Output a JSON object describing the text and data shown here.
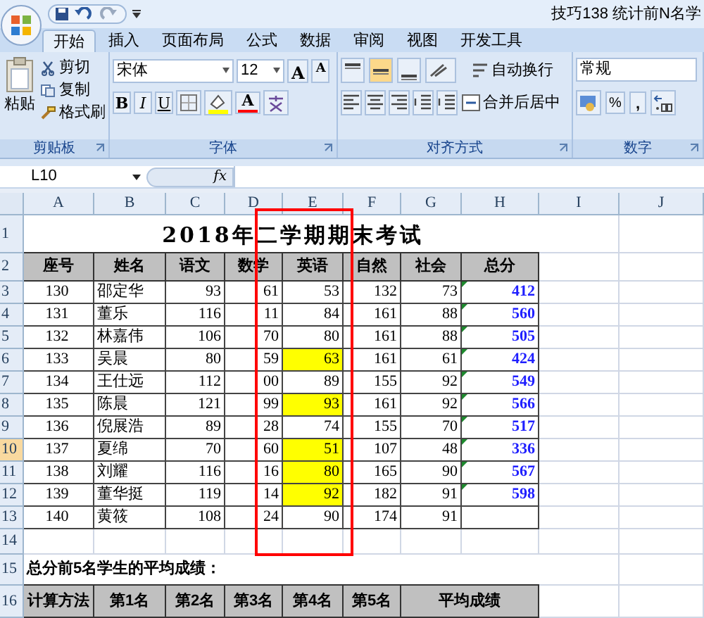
{
  "window": {
    "title": "技巧138 统计前N名学"
  },
  "tabs": [
    {
      "label": "开始",
      "selected": true
    },
    {
      "label": "插入",
      "selected": false
    },
    {
      "label": "页面布局",
      "selected": false
    },
    {
      "label": "公式",
      "selected": false
    },
    {
      "label": "数据",
      "selected": false
    },
    {
      "label": "审阅",
      "selected": false
    },
    {
      "label": "视图",
      "selected": false
    },
    {
      "label": "开发工具",
      "selected": false
    }
  ],
  "ribbon": {
    "clipboard": {
      "label": "剪贴板",
      "paste": "粘贴",
      "items": [
        "剪切",
        "复制",
        "格式刷"
      ]
    },
    "font": {
      "label": "字体",
      "font_name": "宋体",
      "font_size": "12",
      "grow": "A",
      "shrink": "A",
      "styles": [
        "B",
        "I",
        "U"
      ],
      "font_color": "A"
    },
    "alignment": {
      "label": "对齐方式",
      "wrap": "自动换行",
      "merge": "合并后居中"
    },
    "number": {
      "label": "数字",
      "format": "常规",
      "percent": "%",
      "comma": ","
    }
  },
  "formula_bar": {
    "name_box": "L10",
    "fx": "fx"
  },
  "columns": [
    "A",
    "B",
    "C",
    "D",
    "E",
    "F",
    "G",
    "H",
    "I",
    "J"
  ],
  "row_headers": [
    {
      "label": "1",
      "selected": false
    },
    {
      "label": "2",
      "selected": false
    },
    {
      "label": "3",
      "selected": false
    },
    {
      "label": "4",
      "selected": false
    },
    {
      "label": "5",
      "selected": false
    },
    {
      "label": "6",
      "selected": false
    },
    {
      "label": "7",
      "selected": false
    },
    {
      "label": "8",
      "selected": false
    },
    {
      "label": "9",
      "selected": false
    },
    {
      "label": "10",
      "selected": true
    },
    {
      "label": "11",
      "selected": false
    },
    {
      "label": "12",
      "selected": false
    },
    {
      "label": "13",
      "selected": false
    },
    {
      "label": "14",
      "selected": false
    },
    {
      "label": "15",
      "selected": false
    },
    {
      "label": "16",
      "selected": false
    }
  ],
  "sheet": {
    "title": "2018年二学期期末考试",
    "header": [
      "座号",
      "姓名",
      "语文",
      "数学",
      "英语",
      "自然",
      "社会",
      "总分"
    ],
    "rows": [
      {
        "cells": [
          "130",
          "邵定华",
          "93",
          "61",
          "53",
          "132",
          "73",
          "412"
        ],
        "english_highlight": false
      },
      {
        "cells": [
          "131",
          "董乐",
          "116",
          "11",
          "84",
          "161",
          "88",
          "560"
        ],
        "english_highlight": false
      },
      {
        "cells": [
          "132",
          "林嘉伟",
          "106",
          "70",
          "80",
          "161",
          "88",
          "505"
        ],
        "english_highlight": false
      },
      {
        "cells": [
          "133",
          "吴晨",
          "80",
          "59",
          "63",
          "161",
          "61",
          "424"
        ],
        "english_highlight": true
      },
      {
        "cells": [
          "134",
          "王仕远",
          "112",
          "00",
          "89",
          "155",
          "92",
          "549"
        ],
        "english_highlight": false
      },
      {
        "cells": [
          "135",
          "陈晨",
          "121",
          "99",
          "93",
          "161",
          "92",
          "566"
        ],
        "english_highlight": true
      },
      {
        "cells": [
          "136",
          "倪展浩",
          "89",
          "28",
          "74",
          "155",
          "70",
          "517"
        ],
        "english_highlight": false
      },
      {
        "cells": [
          "137",
          "夏绵",
          "70",
          "60",
          "51",
          "107",
          "48",
          "336"
        ],
        "english_highlight": true
      },
      {
        "cells": [
          "138",
          "刘耀",
          "116",
          "16",
          "80",
          "165",
          "90",
          "567"
        ],
        "english_highlight": true
      },
      {
        "cells": [
          "139",
          "董华挺",
          "119",
          "14",
          "92",
          "182",
          "91",
          "598"
        ],
        "english_highlight": true
      },
      {
        "cells": [
          "140",
          "黄筱",
          "108",
          "24",
          "90",
          "174",
          "91"
        ],
        "english_highlight": false
      }
    ],
    "note": "总分前5名学生的平均成绩：",
    "summary_header": [
      "计算方法",
      "第1名",
      "第2名",
      "第3名",
      "第4名",
      "第5名",
      "平均成绩"
    ]
  }
}
